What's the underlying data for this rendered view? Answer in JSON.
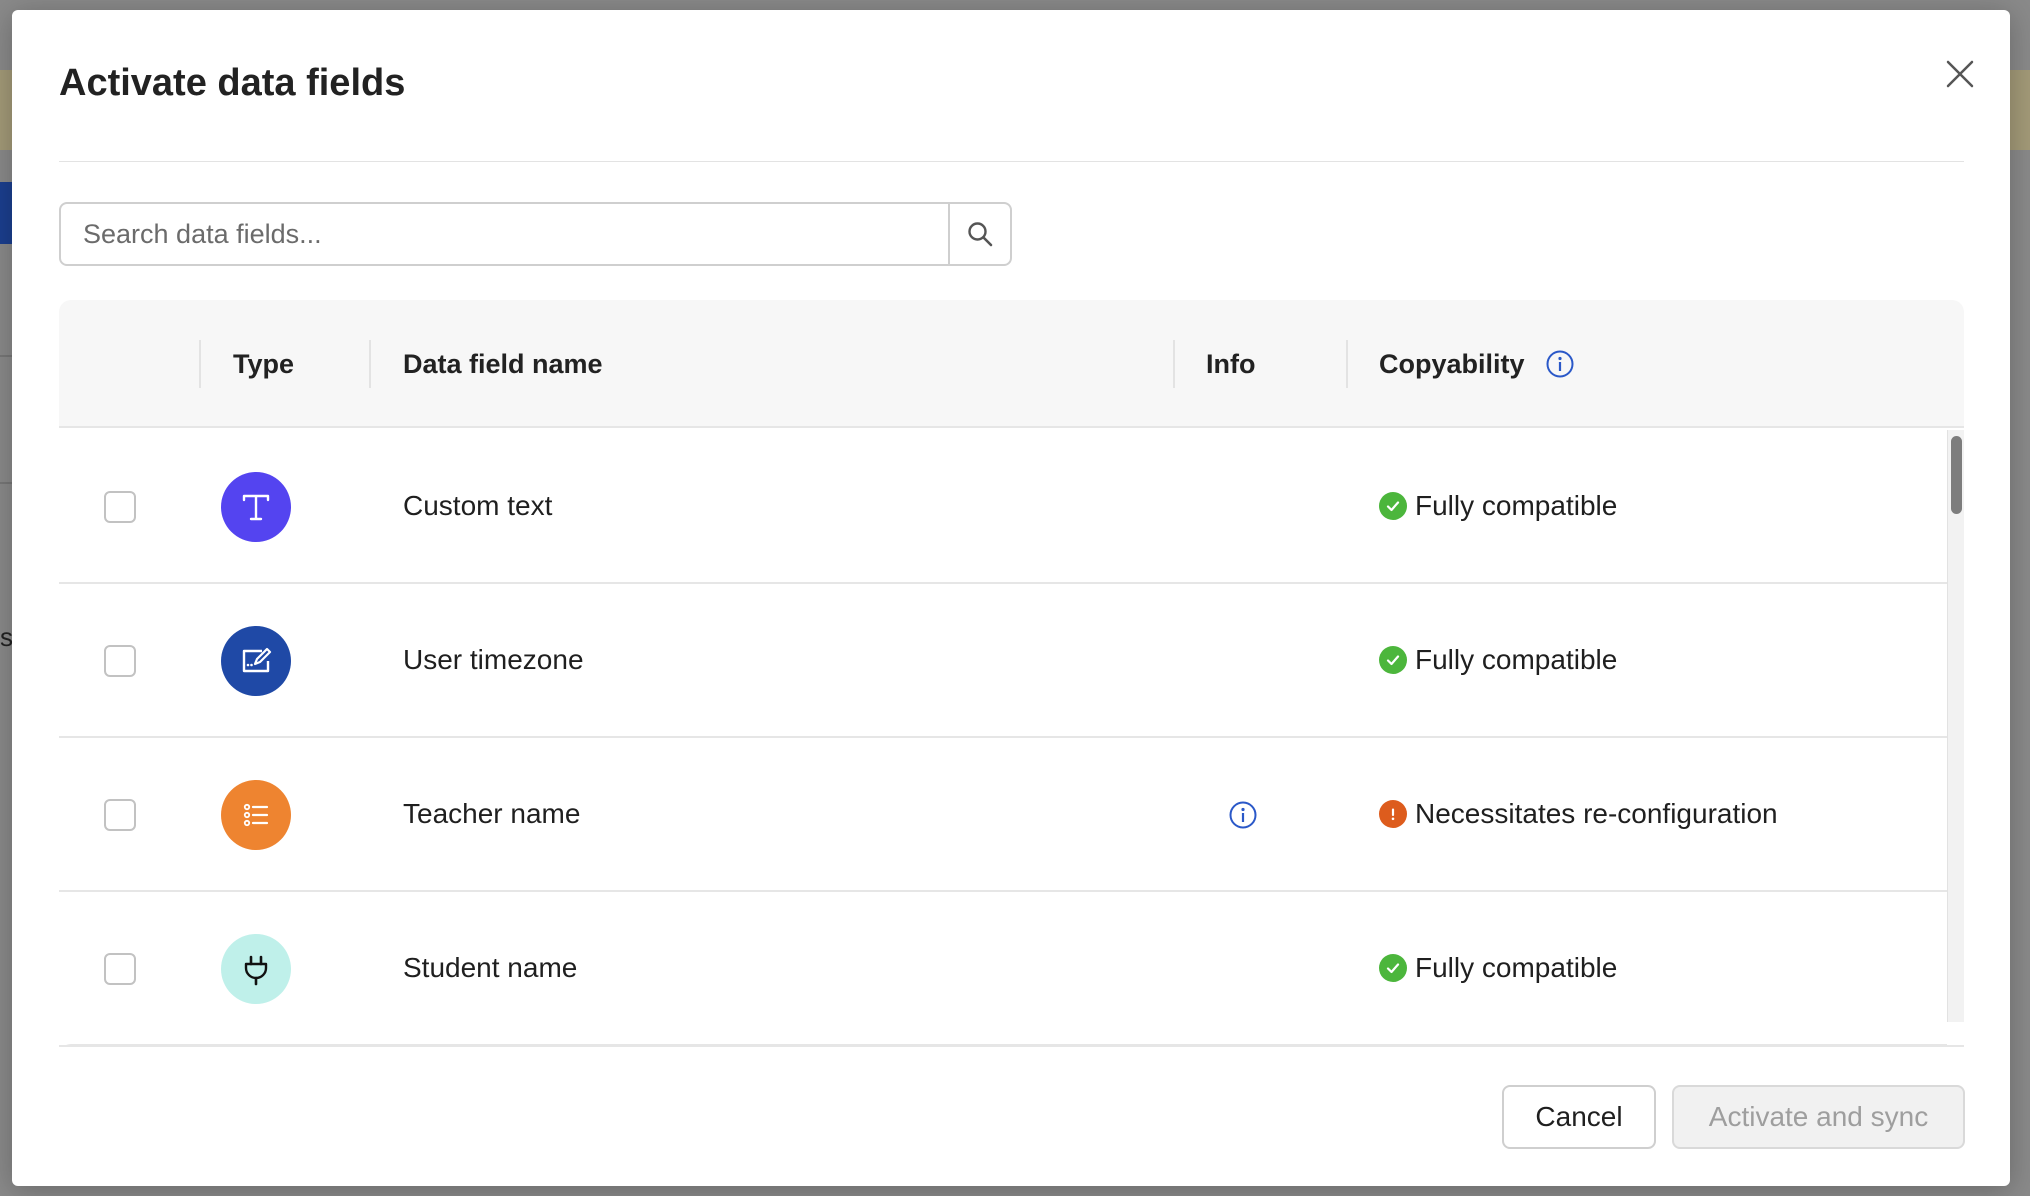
{
  "modal": {
    "title": "Activate data fields"
  },
  "search": {
    "placeholder": "Search data fields..."
  },
  "table": {
    "columns": {
      "type": "Type",
      "name": "Data field name",
      "info": "Info",
      "copyability": "Copyability"
    },
    "rows": [
      {
        "name": "Custom text",
        "type_icon": "text-type-icon",
        "icon_color": "#5444f0",
        "has_info": false,
        "status": "Fully compatible",
        "status_kind": "ok"
      },
      {
        "name": "User timezone",
        "type_icon": "edit-field-type-icon",
        "icon_color": "#1f49a6",
        "has_info": false,
        "status": "Fully compatible",
        "status_kind": "ok"
      },
      {
        "name": "Teacher name",
        "type_icon": "list-type-icon",
        "icon_color": "#ee8430",
        "has_info": true,
        "status": "Necessitates re-configuration",
        "status_kind": "warning"
      },
      {
        "name": "Student name",
        "type_icon": "plug-type-icon",
        "icon_color": "#bff0ea",
        "has_info": false,
        "status": "Fully compatible",
        "status_kind": "ok"
      }
    ]
  },
  "footer": {
    "cancel_label": "Cancel",
    "activate_label": "Activate and sync"
  },
  "background": {
    "partial_text": "s"
  },
  "colors": {
    "ok": "#4cb63c",
    "warning": "#dd5c1d",
    "info_blue": "#2a58c8"
  }
}
